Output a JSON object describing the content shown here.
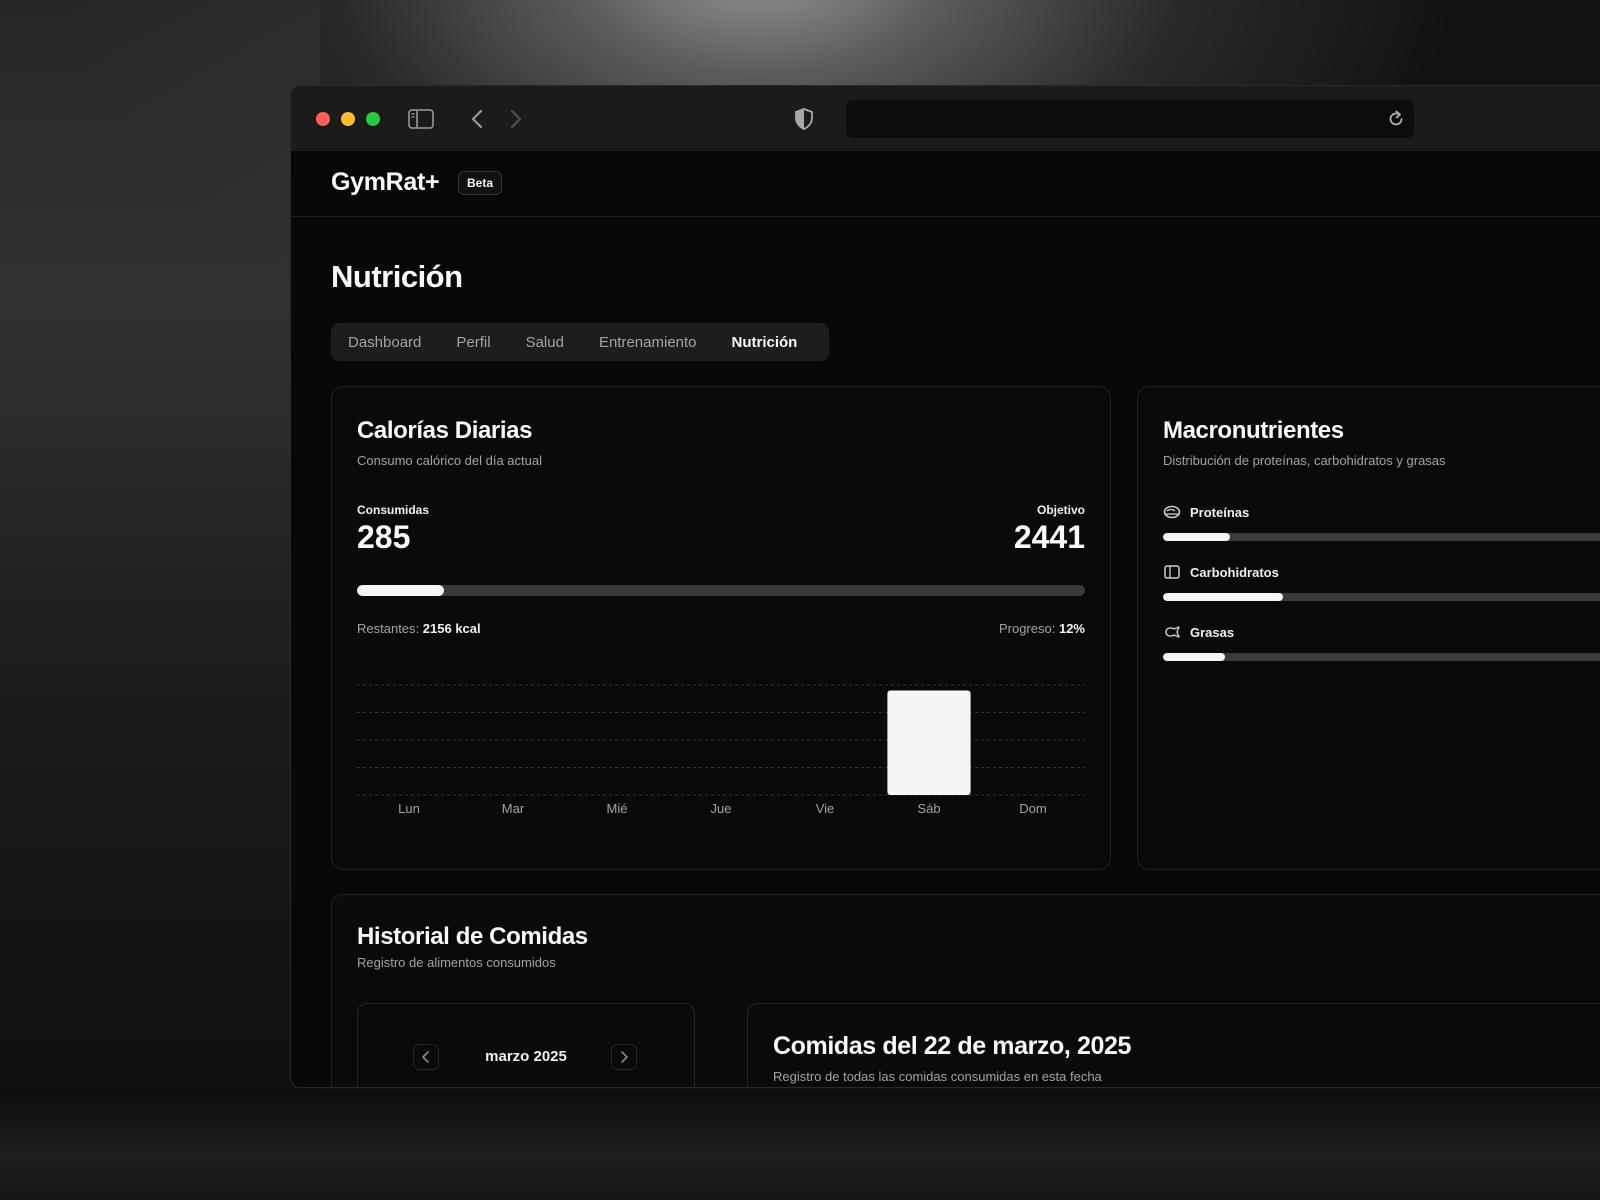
{
  "app": {
    "brand": "GymRat+",
    "badge": "Beta"
  },
  "page": {
    "title": "Nutrición"
  },
  "tabs": [
    {
      "label": "Dashboard",
      "active": false
    },
    {
      "label": "Perfil",
      "active": false
    },
    {
      "label": "Salud",
      "active": false
    },
    {
      "label": "Entrenamiento",
      "active": false
    },
    {
      "label": "Nutrición",
      "active": true
    }
  ],
  "calories": {
    "title": "Calorías Diarias",
    "subtitle": "Consumo calórico del día actual",
    "consumed_label": "Consumidas",
    "consumed_value": "285",
    "goal_label": "Objetivo",
    "goal_value": "2441",
    "progress_fraction": 0.12,
    "remaining_label": "Restantes:",
    "remaining_value": "2156 kcal",
    "progress_label": "Progreso:",
    "progress_value": "12%"
  },
  "chart_data": {
    "type": "bar",
    "categories": [
      "Lun",
      "Mar",
      "Mié",
      "Jue",
      "Vie",
      "Sáb",
      "Dom"
    ],
    "values": [
      0,
      0,
      0,
      0,
      0,
      285,
      0
    ],
    "ylim": [
      0,
      300
    ],
    "grid": true,
    "bar_color": "#f5f5f5"
  },
  "macros": {
    "title": "Macronutrientes",
    "subtitle": "Distribución de proteínas, carbohidratos y grasas",
    "items": [
      {
        "name": "Proteínas",
        "icon": "protein-icon",
        "fraction": 0.14
      },
      {
        "name": "Carbohidratos",
        "icon": "carbs-icon",
        "fraction": 0.25
      },
      {
        "name": "Grasas",
        "icon": "fats-icon",
        "fraction": 0.13
      }
    ]
  },
  "history": {
    "title": "Historial de Comidas",
    "subtitle": "Registro de alimentos consumidos",
    "month": "marzo 2025",
    "meals_title": "Comidas del 22 de marzo, 2025",
    "meals_subtitle": "Registro de todas las comidas consumidas en esta fecha"
  }
}
